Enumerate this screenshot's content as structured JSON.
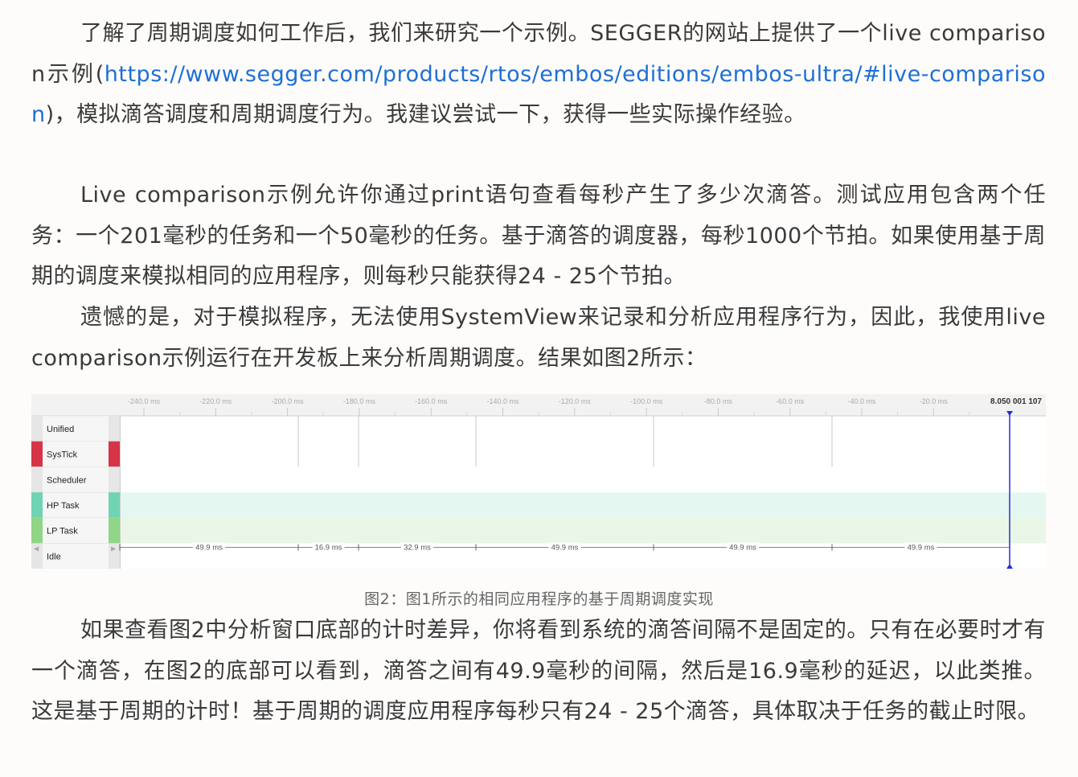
{
  "article": {
    "p1": {
      "text_before": "了解了周期调度如何工作后，我们来研究一个示例。SEGGER的网站上提供了一个live comparison示例(",
      "link": "https://www.segger.com/products/rtos/embos/editions/embos-ultra/#live-comparison",
      "text_after": ")，模拟滴答调度和周期调度行为。我建议尝试一下，获得一些实际操作经验。"
    },
    "p2": "Live comparison示例允许你通过print语句查看每秒产生了多少次滴答。测试应用包含两个任务：一个201毫秒的任务和一个50毫秒的任务。基于滴答的调度器，每秒1000个节拍。如果使用基于周期的调度来模拟相同的应用程序，则每秒只能获得24 - 25个节拍。",
    "p3": "遗憾的是，对于模拟程序，无法使用SystemView来记录和分析应用程序行为，因此，我使用live comparison示例运行在开发板上来分析周期调度。结果如图2所示：",
    "caption": "图2：图1所示的相同应用程序的基于周期调度实现",
    "p4": "如果查看图2中分析窗口底部的计时差异，你将看到系统的滴答间隔不是固定的。只有在必要时才有一个滴答，在图2的底部可以看到，滴答之间有49.9毫秒的间隔，然后是16.9毫秒的延迟，以此类推。这是基于周期的计时！基于周期的调度应用程序每秒只有24 - 25个滴答，具体取决于任务的截止时限。"
  },
  "timeline": {
    "axis_ticks": [
      "-240.0 ms",
      "-220.0 ms",
      "-200.0 ms",
      "-180.0 ms",
      "-160.0 ms",
      "-140.0 ms",
      "-120.0 ms",
      "-100.0 ms",
      "-80.0 ms",
      "-60.0 ms",
      "-40.0 ms",
      "-20.0 ms"
    ],
    "cursor_time": "8.050 001 107",
    "rows": [
      {
        "label": "Unified",
        "color": "#e6e6e6",
        "band": ""
      },
      {
        "label": "SysTick",
        "color": "#d63447",
        "band": ""
      },
      {
        "label": "Scheduler",
        "color": "#e6e6e6",
        "band": ""
      },
      {
        "label": "HP Task",
        "color": "#6fd3b4",
        "band": "#e5f7f1"
      },
      {
        "label": "LP Task",
        "color": "#8fd686",
        "band": "#eaf7e8"
      },
      {
        "label": "Idle",
        "color": "#e6e6e6",
        "band": ""
      }
    ],
    "intervals": [
      "49.9 ms",
      "16.9 ms",
      "32.9 ms",
      "49.9 ms",
      "49.9 ms",
      "49.9 ms"
    ],
    "colors": {
      "cursor": "#2b2bd6",
      "grid": "#d0d0d0",
      "axis_bg": "#f2f2f2"
    }
  }
}
